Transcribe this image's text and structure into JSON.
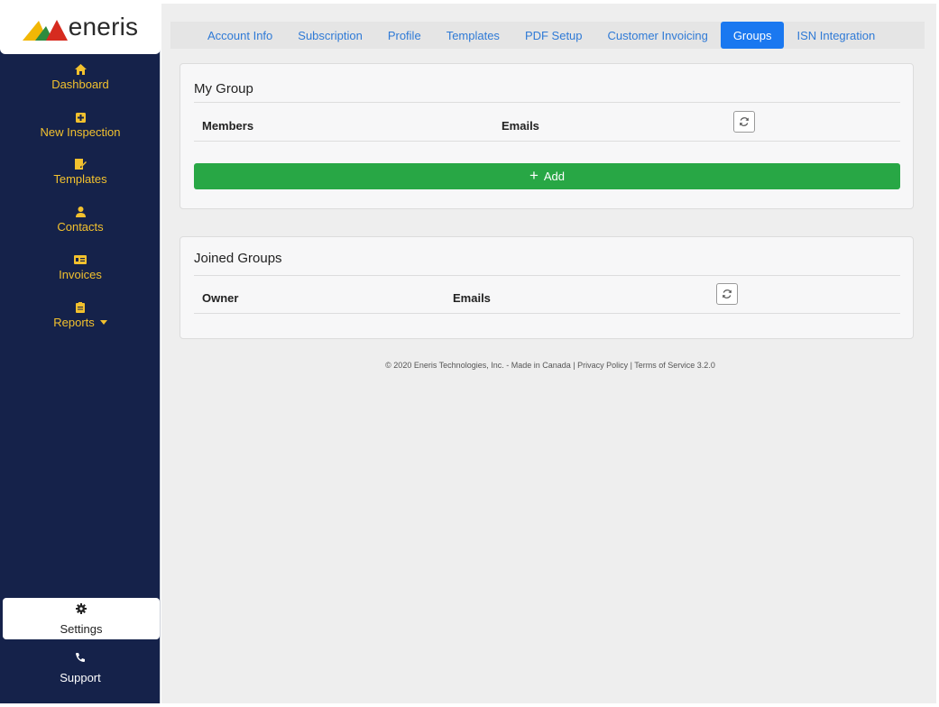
{
  "brand": {
    "name": "eneris"
  },
  "sidebar": {
    "items": [
      {
        "label": "Dashboard",
        "icon": "home-icon"
      },
      {
        "label": "New Inspection",
        "icon": "plus-square-icon"
      },
      {
        "label": "Templates",
        "icon": "edit-file-icon"
      },
      {
        "label": "Contacts",
        "icon": "user-icon"
      },
      {
        "label": "Invoices",
        "icon": "invoice-icon"
      },
      {
        "label": "Reports",
        "icon": "clipboard-icon"
      }
    ],
    "settings_label": "Settings",
    "support_label": "Support"
  },
  "tabs": [
    {
      "label": "Account Info",
      "active": false
    },
    {
      "label": "Subscription",
      "active": false
    },
    {
      "label": "Profile",
      "active": false
    },
    {
      "label": "Templates",
      "active": false
    },
    {
      "label": "PDF Setup",
      "active": false
    },
    {
      "label": "Customer Invoicing",
      "active": false
    },
    {
      "label": "Groups",
      "active": true
    },
    {
      "label": "ISN Integration",
      "active": false
    }
  ],
  "my_group": {
    "title": "My Group",
    "col_members": "Members",
    "col_emails": "Emails",
    "add_label": "Add"
  },
  "joined_groups": {
    "title": "Joined Groups",
    "col_owner": "Owner",
    "col_emails": "Emails"
  },
  "footer": {
    "text": "© 2020 Eneris Technologies, Inc. - Made in Canada | Privacy Policy | Terms of Service 3.2.0"
  },
  "colors": {
    "sidebar_bg": "#15224a",
    "nav_accent": "#f2c12e",
    "tab_active": "#1a78f0",
    "tab_link": "#2f7ad6",
    "add_button": "#28a745"
  }
}
